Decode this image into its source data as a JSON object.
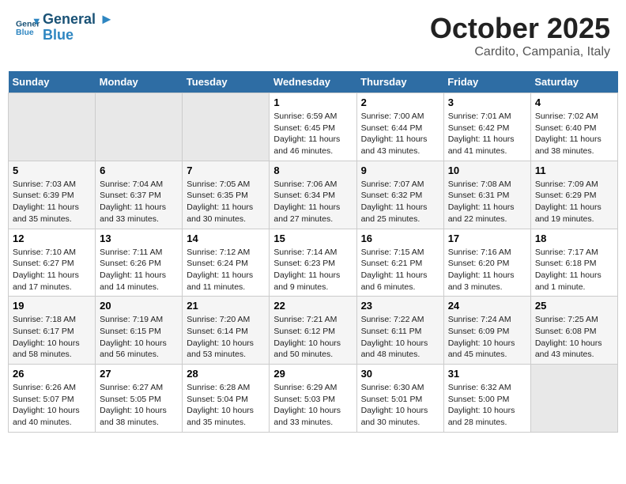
{
  "header": {
    "logo_line1": "General",
    "logo_line2": "Blue",
    "month": "October 2025",
    "location": "Cardito, Campania, Italy"
  },
  "weekdays": [
    "Sunday",
    "Monday",
    "Tuesday",
    "Wednesday",
    "Thursday",
    "Friday",
    "Saturday"
  ],
  "weeks": [
    [
      {
        "day": "",
        "info": ""
      },
      {
        "day": "",
        "info": ""
      },
      {
        "day": "",
        "info": ""
      },
      {
        "day": "1",
        "info": "Sunrise: 6:59 AM\nSunset: 6:45 PM\nDaylight: 11 hours\nand 46 minutes."
      },
      {
        "day": "2",
        "info": "Sunrise: 7:00 AM\nSunset: 6:44 PM\nDaylight: 11 hours\nand 43 minutes."
      },
      {
        "day": "3",
        "info": "Sunrise: 7:01 AM\nSunset: 6:42 PM\nDaylight: 11 hours\nand 41 minutes."
      },
      {
        "day": "4",
        "info": "Sunrise: 7:02 AM\nSunset: 6:40 PM\nDaylight: 11 hours\nand 38 minutes."
      }
    ],
    [
      {
        "day": "5",
        "info": "Sunrise: 7:03 AM\nSunset: 6:39 PM\nDaylight: 11 hours\nand 35 minutes."
      },
      {
        "day": "6",
        "info": "Sunrise: 7:04 AM\nSunset: 6:37 PM\nDaylight: 11 hours\nand 33 minutes."
      },
      {
        "day": "7",
        "info": "Sunrise: 7:05 AM\nSunset: 6:35 PM\nDaylight: 11 hours\nand 30 minutes."
      },
      {
        "day": "8",
        "info": "Sunrise: 7:06 AM\nSunset: 6:34 PM\nDaylight: 11 hours\nand 27 minutes."
      },
      {
        "day": "9",
        "info": "Sunrise: 7:07 AM\nSunset: 6:32 PM\nDaylight: 11 hours\nand 25 minutes."
      },
      {
        "day": "10",
        "info": "Sunrise: 7:08 AM\nSunset: 6:31 PM\nDaylight: 11 hours\nand 22 minutes."
      },
      {
        "day": "11",
        "info": "Sunrise: 7:09 AM\nSunset: 6:29 PM\nDaylight: 11 hours\nand 19 minutes."
      }
    ],
    [
      {
        "day": "12",
        "info": "Sunrise: 7:10 AM\nSunset: 6:27 PM\nDaylight: 11 hours\nand 17 minutes."
      },
      {
        "day": "13",
        "info": "Sunrise: 7:11 AM\nSunset: 6:26 PM\nDaylight: 11 hours\nand 14 minutes."
      },
      {
        "day": "14",
        "info": "Sunrise: 7:12 AM\nSunset: 6:24 PM\nDaylight: 11 hours\nand 11 minutes."
      },
      {
        "day": "15",
        "info": "Sunrise: 7:14 AM\nSunset: 6:23 PM\nDaylight: 11 hours\nand 9 minutes."
      },
      {
        "day": "16",
        "info": "Sunrise: 7:15 AM\nSunset: 6:21 PM\nDaylight: 11 hours\nand 6 minutes."
      },
      {
        "day": "17",
        "info": "Sunrise: 7:16 AM\nSunset: 6:20 PM\nDaylight: 11 hours\nand 3 minutes."
      },
      {
        "day": "18",
        "info": "Sunrise: 7:17 AM\nSunset: 6:18 PM\nDaylight: 11 hours\nand 1 minute."
      }
    ],
    [
      {
        "day": "19",
        "info": "Sunrise: 7:18 AM\nSunset: 6:17 PM\nDaylight: 10 hours\nand 58 minutes."
      },
      {
        "day": "20",
        "info": "Sunrise: 7:19 AM\nSunset: 6:15 PM\nDaylight: 10 hours\nand 56 minutes."
      },
      {
        "day": "21",
        "info": "Sunrise: 7:20 AM\nSunset: 6:14 PM\nDaylight: 10 hours\nand 53 minutes."
      },
      {
        "day": "22",
        "info": "Sunrise: 7:21 AM\nSunset: 6:12 PM\nDaylight: 10 hours\nand 50 minutes."
      },
      {
        "day": "23",
        "info": "Sunrise: 7:22 AM\nSunset: 6:11 PM\nDaylight: 10 hours\nand 48 minutes."
      },
      {
        "day": "24",
        "info": "Sunrise: 7:24 AM\nSunset: 6:09 PM\nDaylight: 10 hours\nand 45 minutes."
      },
      {
        "day": "25",
        "info": "Sunrise: 7:25 AM\nSunset: 6:08 PM\nDaylight: 10 hours\nand 43 minutes."
      }
    ],
    [
      {
        "day": "26",
        "info": "Sunrise: 6:26 AM\nSunset: 5:07 PM\nDaylight: 10 hours\nand 40 minutes."
      },
      {
        "day": "27",
        "info": "Sunrise: 6:27 AM\nSunset: 5:05 PM\nDaylight: 10 hours\nand 38 minutes."
      },
      {
        "day": "28",
        "info": "Sunrise: 6:28 AM\nSunset: 5:04 PM\nDaylight: 10 hours\nand 35 minutes."
      },
      {
        "day": "29",
        "info": "Sunrise: 6:29 AM\nSunset: 5:03 PM\nDaylight: 10 hours\nand 33 minutes."
      },
      {
        "day": "30",
        "info": "Sunrise: 6:30 AM\nSunset: 5:01 PM\nDaylight: 10 hours\nand 30 minutes."
      },
      {
        "day": "31",
        "info": "Sunrise: 6:32 AM\nSunset: 5:00 PM\nDaylight: 10 hours\nand 28 minutes."
      },
      {
        "day": "",
        "info": ""
      }
    ]
  ]
}
